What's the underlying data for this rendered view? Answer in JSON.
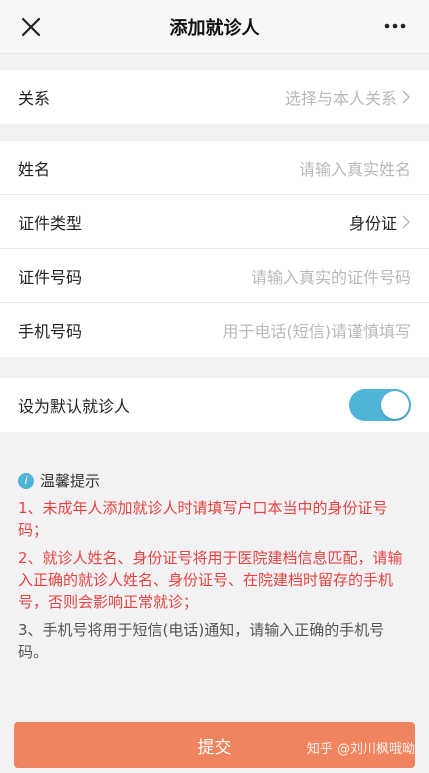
{
  "header": {
    "title": "添加就诊人"
  },
  "relation": {
    "label": "关系",
    "placeholder": "选择与本人关系"
  },
  "form": {
    "name": {
      "label": "姓名",
      "placeholder": "请输入真实姓名"
    },
    "id_type": {
      "label": "证件类型",
      "value": "身份证"
    },
    "id_number": {
      "label": "证件号码",
      "placeholder": "请输入真实的证件号码"
    },
    "phone": {
      "label": "手机号码",
      "placeholder": "用于电话(短信)请谨慎填写"
    }
  },
  "default_patient": {
    "label": "设为默认就诊人",
    "enabled": true
  },
  "tips": {
    "title": "温馨提示",
    "items": [
      "1、未成年人添加就诊人时请填写户口本当中的身份证号码；",
      "2、就诊人姓名、身份证号将用于医院建档信息匹配，请输入正确的就诊人姓名、身份证号、在院建档时留存的手机号，否则会影响正常就诊；",
      "3、手机号将用于短信(电话)通知，请输入正确的手机号码。"
    ]
  },
  "submit_label": "提交",
  "watermark": "知乎 @刘川枫哦呦",
  "colors": {
    "accent": "#4fb4d6",
    "submit": "#f0845f",
    "warning": "#e8433f"
  }
}
